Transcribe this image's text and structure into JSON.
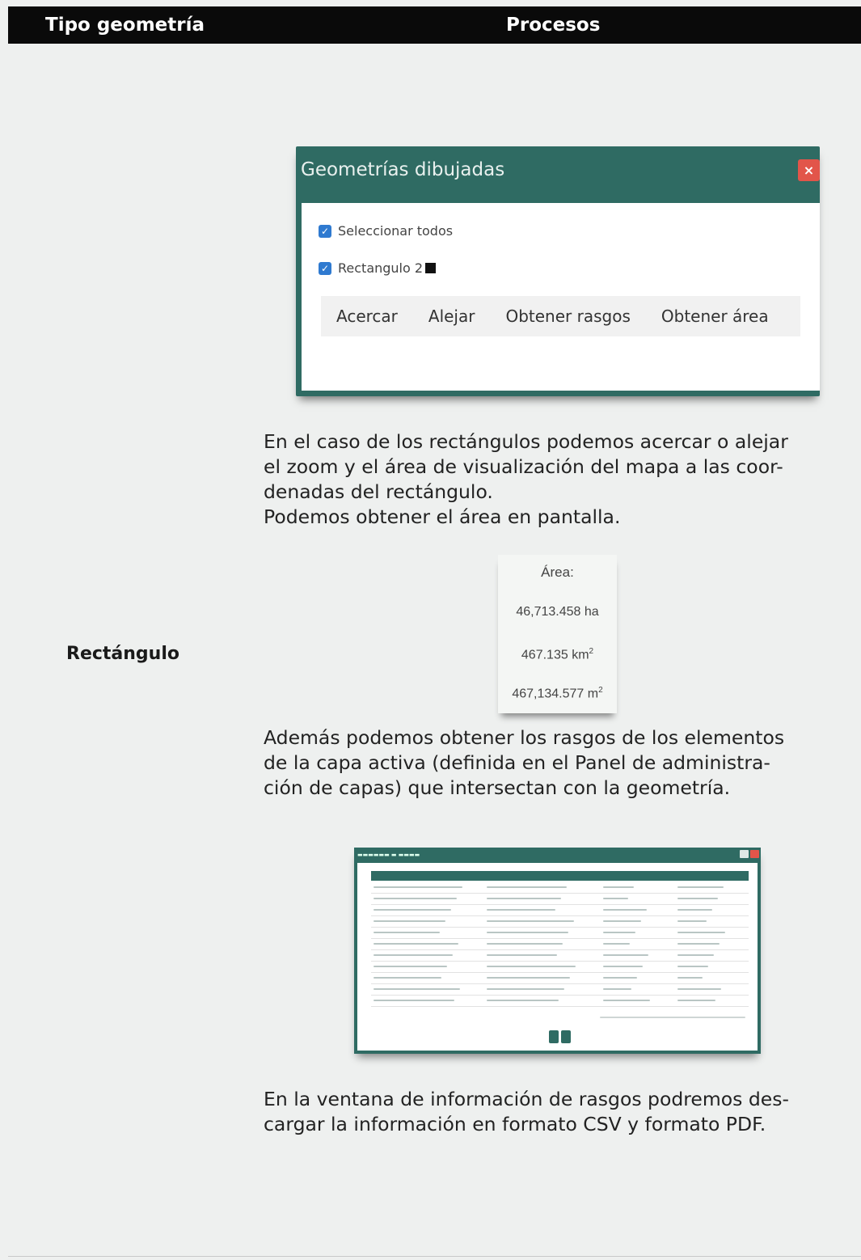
{
  "table_header": {
    "col1": "Tipo geometría",
    "col2": "Procesos"
  },
  "row_label": "Rectángulo",
  "dialog": {
    "title": "Geometrías dibujadas",
    "close_icon": "close-icon",
    "select_all": "Seleccionar todos",
    "item": "Rectangulo 2",
    "buttons": [
      "Acercar",
      "Alejar",
      "Obtener rasgos",
      "Obtener área"
    ],
    "accent": "#2f6b63"
  },
  "paragraphs": [
    "En el caso de los rectángulos podemos acercar o alejar\nel zoom y el área de visualización del mapa a las coor-\ndenadas del rectángulo.\nPodemos obtener el área en pantalla.",
    "Además podemos obtener los rasgos de los elementos\nde la capa activa (definida en el Panel de administra-\nción de capas) que intersectan con la geometría.",
    "En la ventana de información de rasgos podremos des-\ncargar la información en formato CSV y formato PDF."
  ],
  "area": {
    "label": "Área:",
    "ha": "46,713.458 ha",
    "km_value": "467.135 km",
    "m_value": "467,134.577 m",
    "exponent": "2"
  }
}
